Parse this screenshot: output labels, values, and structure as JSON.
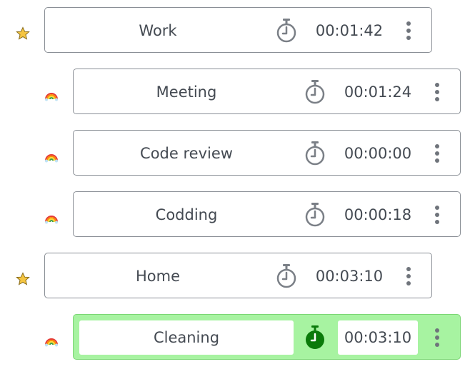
{
  "items": [
    {
      "type": "category",
      "marker": "star-icon",
      "name": "Work",
      "time": "00:01:42",
      "active": false
    },
    {
      "type": "task",
      "marker": "rainbow-icon",
      "name": "Meeting",
      "time": "00:01:24",
      "active": false
    },
    {
      "type": "task",
      "marker": "rainbow-icon",
      "name": "Code review",
      "time": "00:00:00",
      "active": false
    },
    {
      "type": "task",
      "marker": "rainbow-icon",
      "name": "Codding",
      "time": "00:00:18",
      "active": false
    },
    {
      "type": "category",
      "marker": "star-icon",
      "name": "Home",
      "time": "00:03:10",
      "active": false
    },
    {
      "type": "task",
      "marker": "rainbow-icon",
      "name": "Cleaning",
      "time": "00:03:10",
      "active": true
    }
  ],
  "colors": {
    "active_background": "#a7f3a1",
    "active_timer": "#0a7a0a",
    "idle_timer": "#7a7f86",
    "border": "#8a8f96",
    "text": "#444a52",
    "star": "#f5c542"
  }
}
